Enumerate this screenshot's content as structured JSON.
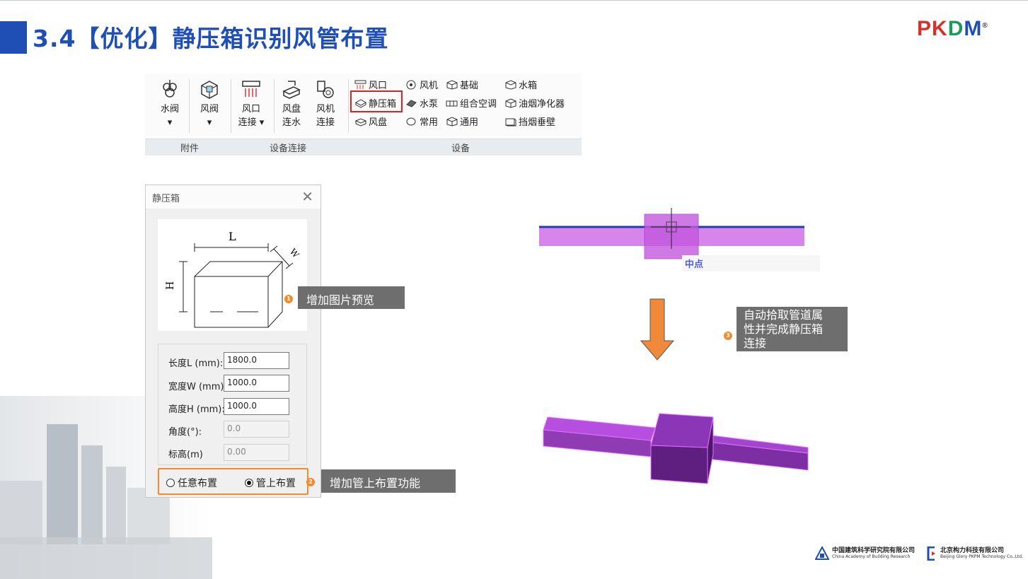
{
  "slide": {
    "title": "3.4【优化】静压箱识别风管布置",
    "logo": {
      "p": "P",
      "k": "K",
      "d": "D",
      "m": "M",
      "reg": "®"
    }
  },
  "ribbon": {
    "buttons": [
      {
        "label1": "水阀",
        "label2": "▾"
      },
      {
        "label1": "风阀",
        "label2": "▾"
      },
      {
        "label1": "风口",
        "label2": "连接 ▾"
      },
      {
        "label1": "风盘",
        "label2": "连水"
      },
      {
        "label1": "风机",
        "label2": "连接"
      }
    ],
    "small_items": {
      "c1": [
        "风口",
        "静压箱",
        "风盘"
      ],
      "c2": [
        "风机",
        "水泵",
        "常用"
      ],
      "c3": [
        "基础",
        "组合空调",
        "通用"
      ],
      "c4": [
        "水箱",
        "油烟净化器",
        "挡烟垂壁"
      ]
    },
    "groups": [
      "附件",
      "设备连接",
      "设备"
    ]
  },
  "dialog": {
    "title": "静压箱",
    "close": "✕",
    "diagram": {
      "l": "L",
      "w": "W",
      "h": "H"
    },
    "fields": [
      {
        "label": "长度L (mm):",
        "value": "1800.0",
        "disabled": false
      },
      {
        "label": "宽度W (mm):",
        "value": "1000.0",
        "disabled": false
      },
      {
        "label": "高度H (mm):",
        "value": "1000.0",
        "disabled": false
      },
      {
        "label": "角度(°):",
        "value": "0.0",
        "disabled": true
      },
      {
        "label": "标高(m)",
        "value": "0.00",
        "disabled": true
      }
    ],
    "modes": [
      {
        "label": "任意布置",
        "selected": false
      },
      {
        "label": "管上布置",
        "selected": true
      }
    ]
  },
  "callouts": {
    "c1": {
      "num": "1",
      "text": "增加图片预览"
    },
    "c2": {
      "num": "2",
      "text": "增加管上布置功能"
    },
    "c3": {
      "num": "3",
      "line1": "自动拾取管道属",
      "line2": "性并完成静压箱",
      "line3": "连接"
    }
  },
  "snap_label": "中点",
  "colors": {
    "accent": "#1f4fb5",
    "callout_num": "#f28a2e",
    "duct": "#d070e8",
    "box3d": "#6a2a90"
  },
  "footer": {
    "org1_cn": "中国建筑科学研究院有限公司",
    "org1_en": "China Academy of Building Research",
    "org2_cn": "北京构力科技有限公司",
    "org2_en": "Beijing Glory PKPM Technology Co.,Ltd."
  }
}
